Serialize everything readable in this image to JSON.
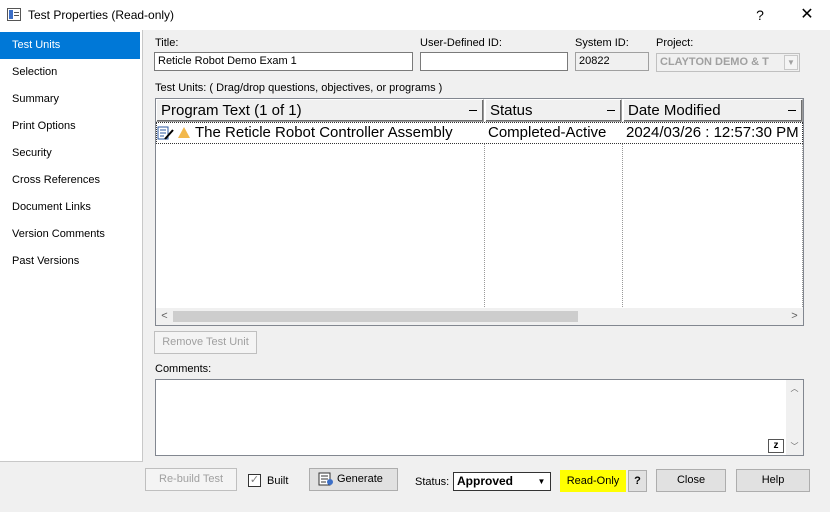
{
  "window": {
    "title": "Test Properties (Read-only)",
    "help_glyph": "?",
    "close_glyph": "✕"
  },
  "sidebar": {
    "items": [
      {
        "label": "Test Units"
      },
      {
        "label": "Selection"
      },
      {
        "label": "Summary"
      },
      {
        "label": "Print Options"
      },
      {
        "label": "Security"
      },
      {
        "label": "Cross References"
      },
      {
        "label": "Document Links"
      },
      {
        "label": "Version Comments"
      },
      {
        "label": "Past Versions"
      }
    ],
    "active_index": 0
  },
  "form": {
    "title_label": "Title:",
    "title_value": "Reticle Robot Demo Exam 1",
    "user_id_label": "User-Defined ID:",
    "user_id_value": "",
    "system_id_label": "System ID:",
    "system_id_value": "20822",
    "project_label": "Project:",
    "project_value": "CLAYTON DEMO & T",
    "test_units_label": "Test Units:   ( Drag/drop questions, objectives, or programs )"
  },
  "grid": {
    "columns": [
      "Program Text (1 of 1)",
      "Status",
      "Date Modified"
    ],
    "rows": [
      {
        "program_text": "The Reticle Robot Controller Assembly",
        "status": "Completed-Active",
        "date_modified": "2024/03/26 : 12:57:30 PM"
      }
    ],
    "scroll_left": "<",
    "scroll_right": ">"
  },
  "buttons": {
    "remove_test_unit": "Remove Test Unit",
    "rebuild_test": "Re-build Test",
    "built": "Built",
    "generate": "Generate",
    "read_only": "Read-Only",
    "question": "?",
    "close": "Close",
    "help": "Help"
  },
  "comments": {
    "label": "Comments:",
    "value": "",
    "z_label": "z"
  },
  "status": {
    "label": "Status:",
    "value": "Approved",
    "built_checked": true
  },
  "colors": {
    "accent": "#0078d7",
    "read_only_highlight": "#ffff00",
    "warning_triangle": "#f2b84b"
  }
}
